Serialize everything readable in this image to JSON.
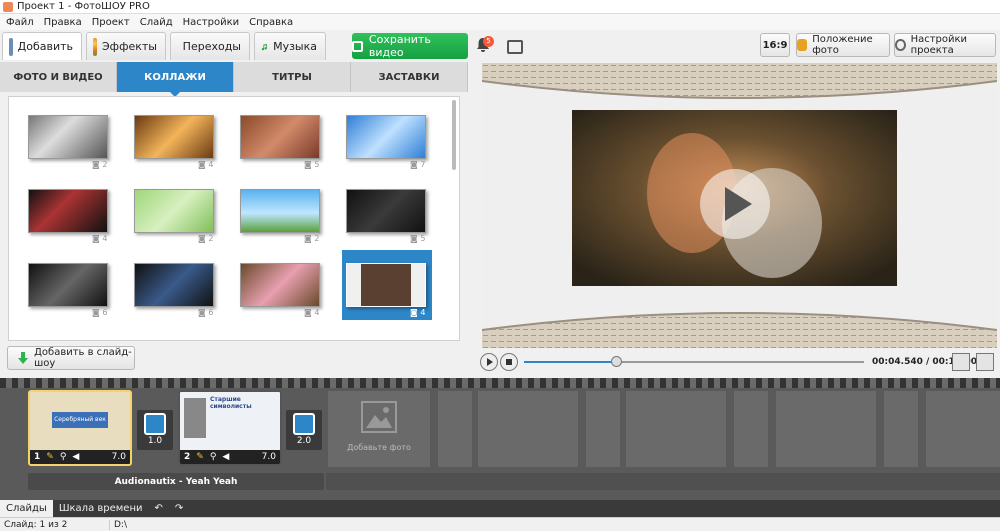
{
  "window": {
    "title": "Проект 1 - ФотоШОУ PRO"
  },
  "menu": [
    "Файл",
    "Правка",
    "Проект",
    "Слайд",
    "Настройки",
    "Справка"
  ],
  "toolbar": {
    "tabs": [
      {
        "label": "Добавить",
        "icon": "add-photo-icon"
      },
      {
        "label": "Эффекты",
        "icon": "palette-icon"
      },
      {
        "label": "Переходы",
        "icon": "star-icon"
      },
      {
        "label": "Музыка",
        "icon": "music-note-icon"
      }
    ],
    "save_label": "Сохранить видео",
    "notif_count": "5",
    "aspect_label": "16:9",
    "photo_position_label": "Положение фото",
    "project_settings_label": "Настройки проекта"
  },
  "subtabs": [
    "ФОТО И ВИДЕО",
    "КОЛЛАЖИ",
    "ТИТРЫ",
    "ЗАСТАВКИ"
  ],
  "gallery": {
    "rows": [
      [
        "2",
        "4",
        "5",
        "7"
      ],
      [
        "4",
        "2",
        "2",
        "5"
      ],
      [
        "6",
        "6",
        "4",
        "4"
      ]
    ]
  },
  "add_to_show_label": "Добавить в слайд-шоу",
  "player": {
    "time": "00:04.540 / 00:13.000",
    "progress": 0.27
  },
  "slides": [
    {
      "num": "1",
      "duration": "7.0",
      "caption": "Серебряный век"
    },
    {
      "num": "2",
      "duration": "7.0",
      "caption": "Старшие символисты"
    }
  ],
  "transitions": [
    "1.0",
    "2.0"
  ],
  "add_photo_label": "Добавьте фото",
  "audio_track": "Audionautix - Yeah Yeah",
  "bottom_tabs": [
    "Слайды",
    "Шкала времени"
  ],
  "status": {
    "slide": "Слайд: 1 из 2",
    "path": "D:\\"
  },
  "colors": {
    "accent": "#2d86c8",
    "save_green": "#1fae4b",
    "badge": "#f25a3a"
  }
}
